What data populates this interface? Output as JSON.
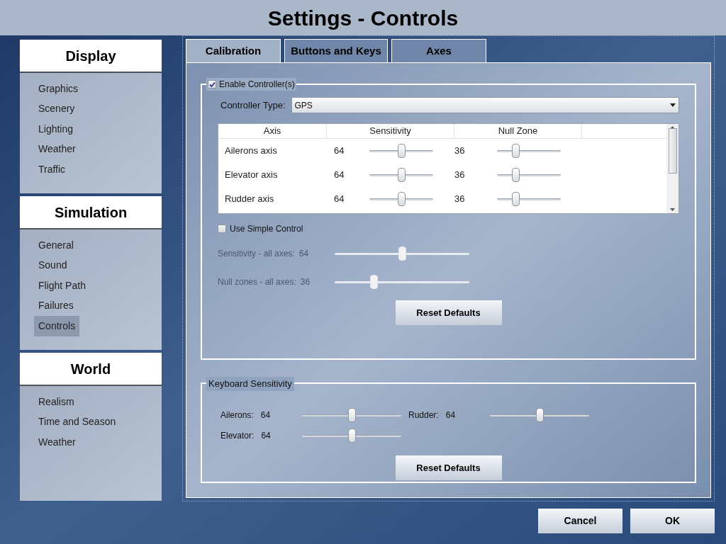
{
  "window": {
    "title": "Settings - Controls"
  },
  "sidebar": [
    {
      "heading": "Display",
      "items": [
        {
          "label": "Graphics",
          "selected": false
        },
        {
          "label": "Scenery",
          "selected": false
        },
        {
          "label": "Lighting",
          "selected": false
        },
        {
          "label": "Weather",
          "selected": false
        },
        {
          "label": "Traffic",
          "selected": false
        }
      ]
    },
    {
      "heading": "Simulation",
      "items": [
        {
          "label": "General",
          "selected": false
        },
        {
          "label": "Sound",
          "selected": false
        },
        {
          "label": "Flight Path",
          "selected": false
        },
        {
          "label": "Failures",
          "selected": false
        },
        {
          "label": "Controls",
          "selected": true
        }
      ]
    },
    {
      "heading": "World",
      "items": [
        {
          "label": "Realism",
          "selected": false
        },
        {
          "label": "Time and Season",
          "selected": false
        },
        {
          "label": "Weather",
          "selected": false
        }
      ]
    }
  ],
  "tabs": [
    {
      "label": "Calibration",
      "selected": true
    },
    {
      "label": "Buttons and Keys",
      "selected": false
    },
    {
      "label": "Axes",
      "selected": false
    }
  ],
  "controllers": {
    "enable": {
      "label": "Enable Controller(s)",
      "checked": true
    },
    "controller_type": {
      "label": "Controller Type:",
      "value": "GPS"
    },
    "table": {
      "columns": [
        "Axis",
        "Sensitivity",
        "Null Zone"
      ],
      "rows": [
        {
          "axis": "Ailerons axis",
          "sensitivity": {
            "value": "64",
            "level": 0.5
          },
          "null_zone": {
            "value": "36",
            "level": 0.29
          }
        },
        {
          "axis": "Elevator axis",
          "sensitivity": {
            "value": "64",
            "level": 0.5
          },
          "null_zone": {
            "value": "36",
            "level": 0.29
          }
        },
        {
          "axis": "Rudder axis",
          "sensitivity": {
            "value": "64",
            "level": 0.5
          },
          "null_zone": {
            "value": "36",
            "level": 0.29
          }
        }
      ]
    },
    "simple": {
      "label": "Use Simple Control",
      "checked": false
    },
    "simple_sliders": [
      {
        "label": "Sensitivity - all axes:",
        "value": "64",
        "level": 0.5,
        "disabled": true
      },
      {
        "label": "Null zones - all axes:",
        "value": "36",
        "level": 0.29,
        "disabled": true
      }
    ],
    "reset": "Reset Defaults"
  },
  "keyboard": {
    "title": "Keyboard Sensitivity",
    "sliders": [
      {
        "label": "Ailerons:",
        "value": "64",
        "level": 0.5
      },
      {
        "label": "Rudder:",
        "value": "64",
        "level": 0.5
      },
      {
        "label": "Elevator:",
        "value": "64",
        "level": 0.5
      }
    ],
    "reset": "Reset Defaults"
  },
  "buttons": [
    "Cancel",
    "OK"
  ]
}
